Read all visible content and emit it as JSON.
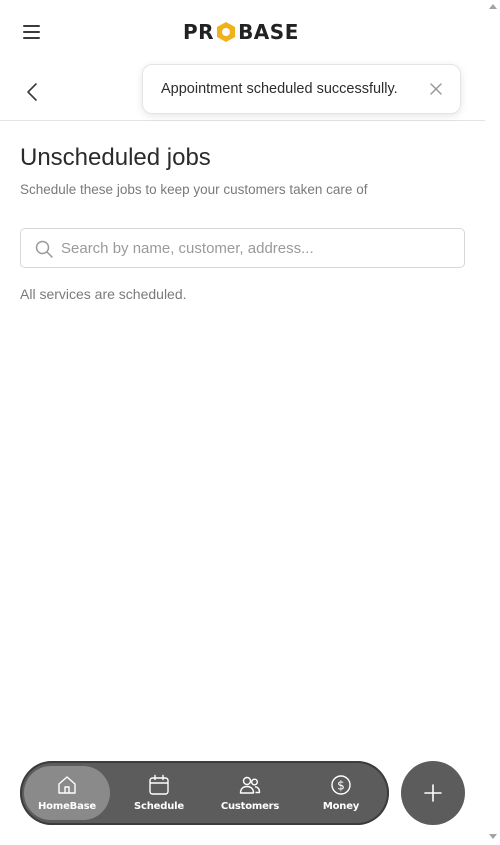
{
  "brand": {
    "logo_text_left": "PR",
    "logo_text_right": "BASE",
    "colors": {
      "accent": "#f0b21b",
      "dark": "#222222"
    }
  },
  "header": {
    "menu_icon": "hamburger-menu-icon",
    "back_icon": "chevron-left-icon"
  },
  "toast": {
    "message": "Appointment scheduled successfully.",
    "close_icon": "close-icon"
  },
  "main": {
    "title": "Unscheduled jobs",
    "subtitle": "Schedule these jobs to keep your customers taken care of",
    "search": {
      "placeholder": "Search by name, customer, address...",
      "value": "",
      "icon": "search-icon"
    },
    "empty_message": "All services are scheduled."
  },
  "bottom_nav": {
    "items": [
      {
        "label": "HomeBase",
        "icon": "home-icon",
        "active": true
      },
      {
        "label": "Schedule",
        "icon": "calendar-icon",
        "active": false
      },
      {
        "label": "Customers",
        "icon": "users-icon",
        "active": false
      },
      {
        "label": "Money",
        "icon": "dollar-icon",
        "active": false
      }
    ],
    "fab_icon": "plus-icon",
    "colors": {
      "bar": "#5c5c5c",
      "active": "#8a8a8a"
    }
  }
}
